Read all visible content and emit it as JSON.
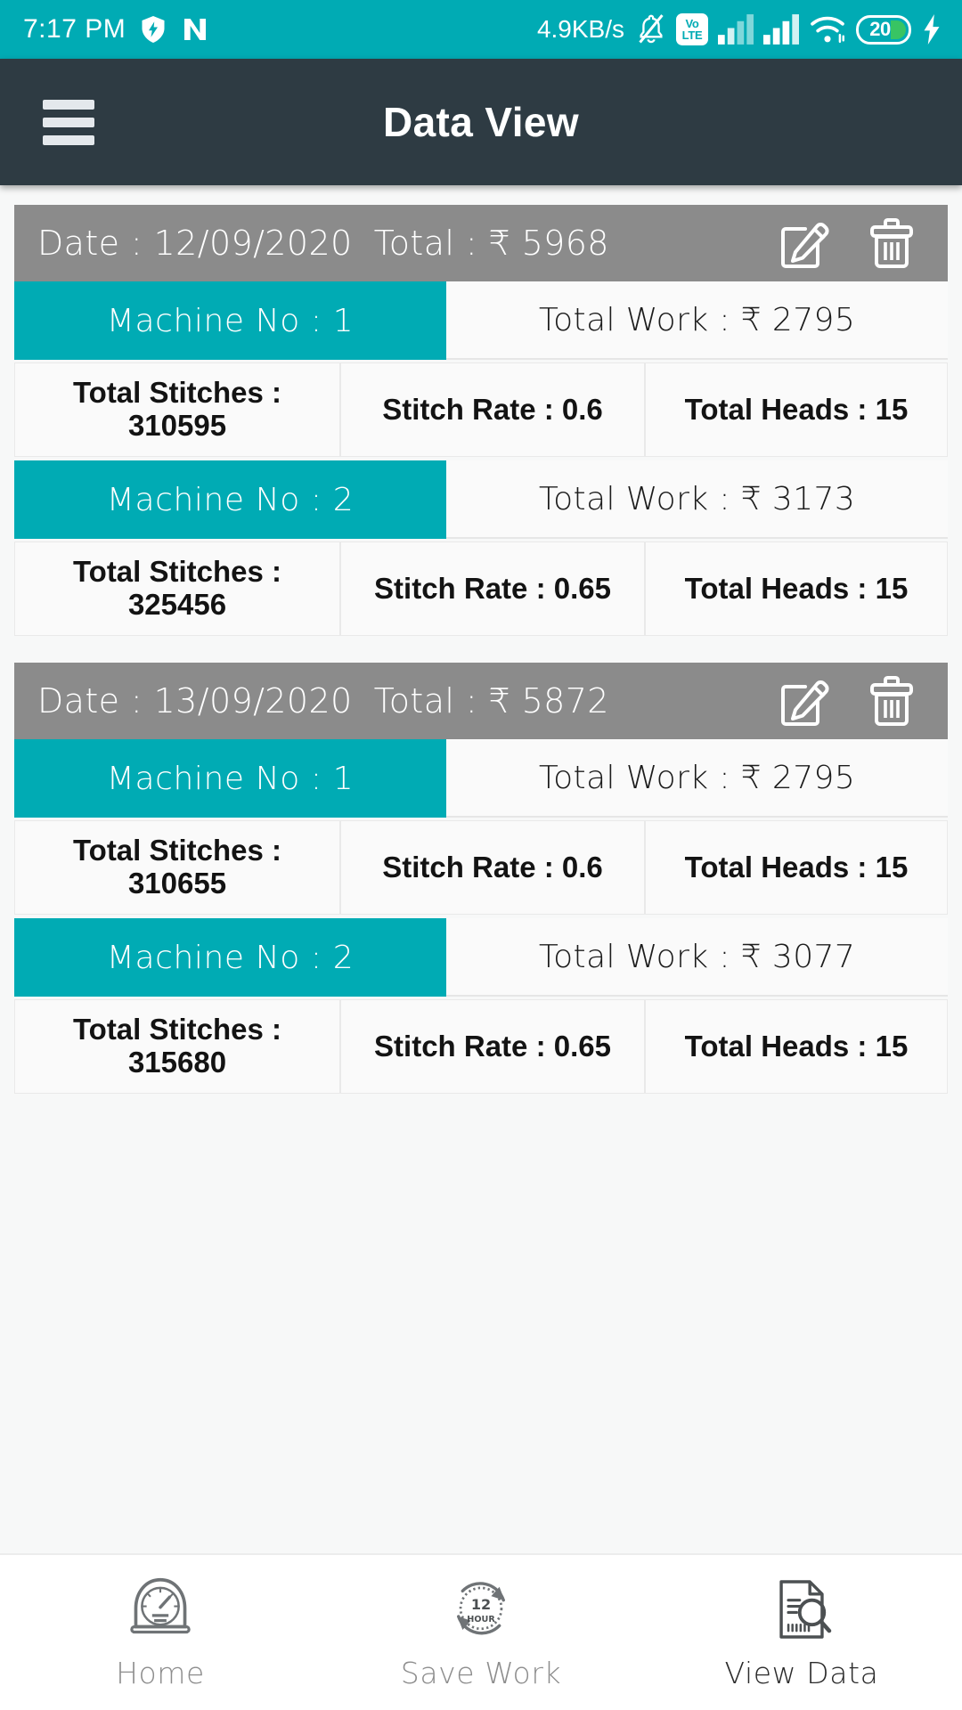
{
  "statusbar": {
    "time": "7:17 PM",
    "shield_icon": "shield-bolt-icon",
    "nfc_icon": "n-logo-icon",
    "network_speed": "4.9KB/s",
    "mute_icon": "bell-muted-icon",
    "volte_top": "Vo",
    "volte_bottom": "LTE",
    "signal1_icon": "signal-bars-icon",
    "signal2_icon": "signal-bars-icon",
    "wifi_icon": "wifi-icon",
    "battery_level": "20",
    "charging_icon": "charging-bolt-icon",
    "accent_color": "#00ABB4"
  },
  "appbar": {
    "menu_icon": "hamburger-menu-icon",
    "title": "Data View",
    "background_color": "#2E3B43"
  },
  "colors": {
    "teal": "#00ABB4",
    "header_gray": "#8b8b8b",
    "cell_bg": "#fafafa"
  },
  "cards": [
    {
      "date_label": "Date : 12/09/2020",
      "total_label": "Total : ₹ 5968",
      "edit_icon": "edit-pencil-icon",
      "delete_icon": "trash-delete-icon",
      "machines": [
        {
          "machine_label": "Machine No : 1",
          "total_work_label": "Total Work : ₹ 2795",
          "total_stitches_label": "Total Stitches : 310595",
          "stitch_rate_label": "Stitch Rate : 0.6",
          "total_heads_label": "Total Heads : 15"
        },
        {
          "machine_label": "Machine No : 2",
          "total_work_label": "Total Work : ₹ 3173",
          "total_stitches_label": "Total Stitches : 325456",
          "stitch_rate_label": "Stitch Rate : 0.65",
          "total_heads_label": "Total Heads : 15"
        }
      ]
    },
    {
      "date_label": "Date : 13/09/2020",
      "total_label": "Total : ₹ 5872",
      "edit_icon": "edit-pencil-icon",
      "delete_icon": "trash-delete-icon",
      "machines": [
        {
          "machine_label": "Machine No : 1",
          "total_work_label": "Total Work : ₹ 2795",
          "total_stitches_label": "Total Stitches : 310655",
          "stitch_rate_label": "Stitch Rate : 0.6",
          "total_heads_label": "Total Heads : 15"
        },
        {
          "machine_label": "Machine No : 2",
          "total_work_label": "Total Work : ₹ 3077",
          "total_stitches_label": "Total Stitches : 315680",
          "stitch_rate_label": "Stitch Rate : 0.65",
          "total_heads_label": "Total Heads : 15"
        }
      ]
    }
  ],
  "bottomnav": {
    "items": [
      {
        "label": "Home",
        "icon": "speedometer-gauge-icon",
        "active": false
      },
      {
        "label": "Save Work",
        "icon": "twelve-hour-clock-icon",
        "active": false
      },
      {
        "label": "View Data",
        "icon": "document-search-icon",
        "active": true
      }
    ]
  }
}
